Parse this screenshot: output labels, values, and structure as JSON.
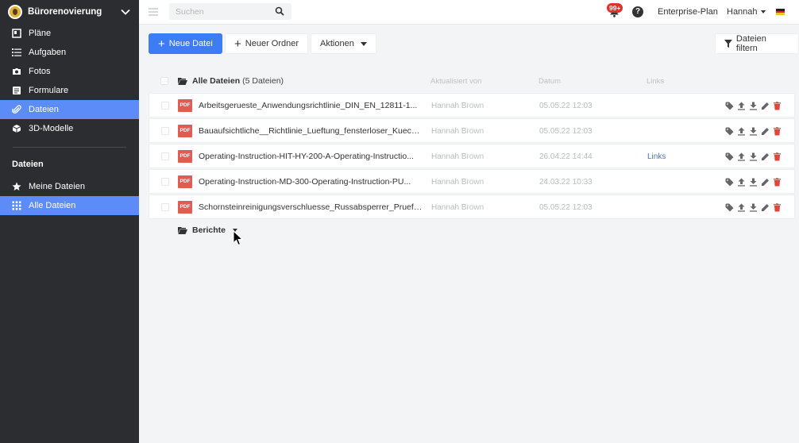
{
  "sidebar": {
    "project_name": "Bürorenovierung",
    "items": [
      {
        "label": "Pläne",
        "icon": "plans-icon"
      },
      {
        "label": "Aufgaben",
        "icon": "list-icon"
      },
      {
        "label": "Fotos",
        "icon": "camera-icon"
      },
      {
        "label": "Formulare",
        "icon": "form-icon"
      },
      {
        "label": "Dateien",
        "icon": "paperclip-icon",
        "active": true
      },
      {
        "label": "3D-Modelle",
        "icon": "cube-icon"
      }
    ],
    "files_section_title": "Dateien",
    "files_items": [
      {
        "label": "Meine Dateien",
        "icon": "star-icon"
      },
      {
        "label": "Alle Dateien",
        "icon": "grid-icon",
        "active": true
      }
    ],
    "active_color": "#5b8cf7"
  },
  "topbar": {
    "search_placeholder": "Suchen",
    "notifications_badge": "99+",
    "help": "?",
    "plan": "Enterprise-Plan",
    "user": "Hannah"
  },
  "toolbar": {
    "new_file": "Neue Datei",
    "new_folder": "Neuer Ordner",
    "actions": "Aktionen",
    "filter": "Dateien filtern",
    "primary_color": "#3d7cf5"
  },
  "file_list": {
    "title": "Alle Dateien",
    "count": "(5 Dateien)",
    "columns": {
      "updated_by": "Aktualisiert von",
      "date": "Datum",
      "links": "Links"
    },
    "rows": [
      {
        "type": "PDF",
        "name": "Arbeitsgerueste_Anwendungsrichtlinie_DIN_EN_12811-1...",
        "updated_by": "Hannah Brown",
        "date": "05.05.22 12:03",
        "links": ""
      },
      {
        "type": "PDF",
        "name": "Bauaufsichtliche__Richtlinie_Lueftung_fensterloser_Kuech...",
        "updated_by": "Hannah Brown",
        "date": "05.05.22 12:03",
        "links": ""
      },
      {
        "type": "PDF",
        "name": "Operating-Instruction-HIT-HY-200-A-Operating-Instructio...",
        "updated_by": "Hannah Brown",
        "date": "26.04.22 14:44",
        "links": "Links"
      },
      {
        "type": "PDF",
        "name": "Operating-Instruction-MD-300-Operating-Instruction-PU...",
        "updated_by": "Hannah Brown",
        "date": "24.03.22 10:33",
        "links": ""
      },
      {
        "type": "PDF",
        "name": "Schornsteinreinigungsverschluesse_Russabsperrer_Pruefg...",
        "updated_by": "Hannah Brown",
        "date": "05.05.22 12:03",
        "links": ""
      }
    ],
    "row_actions": [
      "tag-icon",
      "upload-icon",
      "download-icon",
      "edit-icon",
      "delete-icon"
    ],
    "subfolder": "Berichte"
  }
}
